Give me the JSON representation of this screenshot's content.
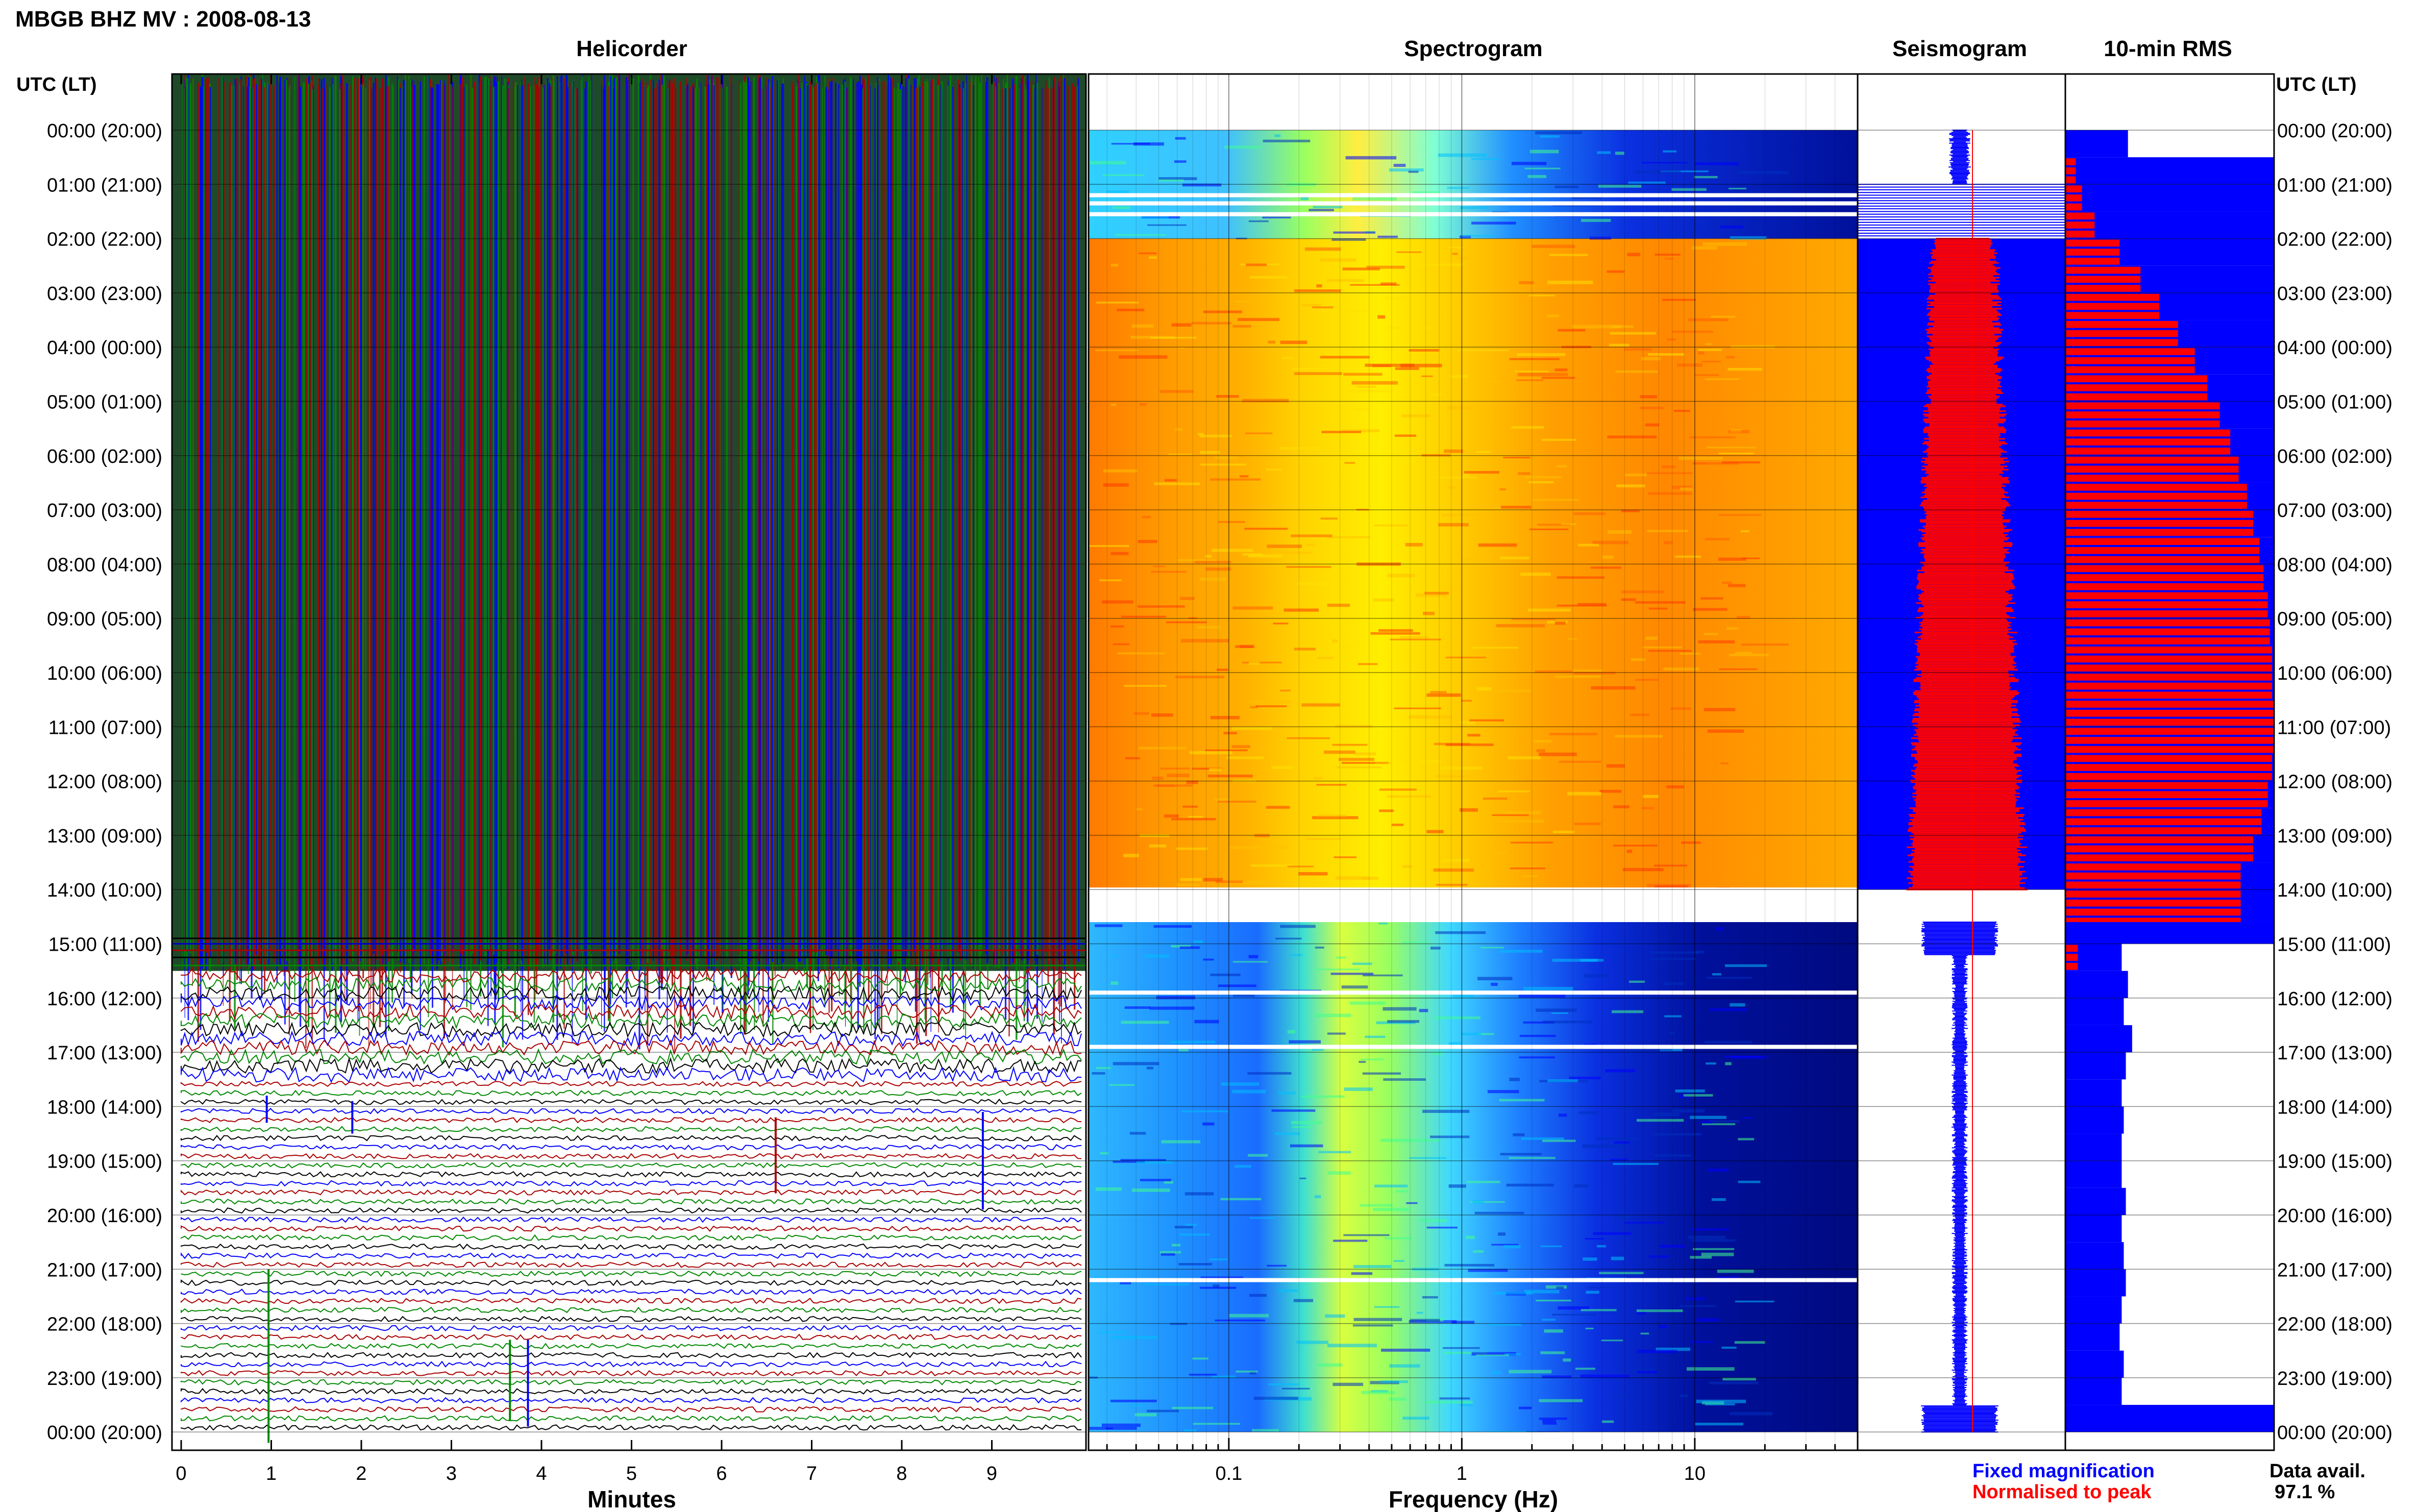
{
  "title": "MBGB BHZ MV : 2008-08-13",
  "time_axis": {
    "label": "UTC (LT)",
    "ticks": [
      "00:00 (20:00)",
      "01:00 (21:00)",
      "02:00 (22:00)",
      "03:00 (23:00)",
      "04:00 (00:00)",
      "05:00 (01:00)",
      "06:00 (02:00)",
      "07:00 (03:00)",
      "08:00 (04:00)",
      "09:00 (05:00)",
      "10:00 (06:00)",
      "11:00 (07:00)",
      "12:00 (08:00)",
      "13:00 (09:00)",
      "14:00 (10:00)",
      "15:00 (11:00)",
      "16:00 (12:00)",
      "17:00 (13:00)",
      "18:00 (14:00)",
      "19:00 (15:00)",
      "20:00 (16:00)",
      "21:00 (17:00)",
      "22:00 (18:00)",
      "23:00 (19:00)",
      "00:00 (20:00)"
    ]
  },
  "panels": {
    "helicorder": {
      "title": "Helicorder",
      "xlabel": "Minutes",
      "xticks": [
        "0",
        "1",
        "2",
        "3",
        "4",
        "5",
        "6",
        "7",
        "8",
        "9"
      ]
    },
    "spectrogram": {
      "title": "Spectrogram",
      "xlabel": "Frequency (Hz)",
      "xticks": [
        "0.1",
        "1",
        "10"
      ]
    },
    "seismogram": {
      "title": "Seismogram"
    },
    "rms": {
      "title": "10-min RMS"
    }
  },
  "legend": {
    "fixed": "Fixed magnification",
    "normalised": "Normalised to peak",
    "fixed_color": "#0000ff",
    "normalised_color": "#ff0000"
  },
  "data_avail": {
    "label": "Data avail.",
    "value": "97.1 %"
  },
  "chart_data": [
    {
      "type": "line",
      "name": "helicorder",
      "x_unit": "minutes",
      "xlim": [
        0,
        10
      ],
      "rows_hours": 24,
      "row_colors": [
        "#0000ff",
        "#aa0000",
        "#008800",
        "#000000"
      ],
      "high_activity_until_hour": 15.5,
      "data_gap_hours": [
        [
          14.0,
          14.6
        ]
      ]
    },
    {
      "type": "heatmap",
      "name": "spectrogram",
      "x_scale": "log",
      "xlim": [
        0.025,
        50
      ],
      "xticks": [
        0.1,
        1,
        10
      ],
      "ylim_hours": [
        0,
        24
      ],
      "data_gap_hours": [
        [
          14.0,
          14.6
        ]
      ],
      "colormap": [
        "#00008b",
        "#0000ff",
        "#00bfff",
        "#7fffd4",
        "#ffff00",
        "#ff8c00",
        "#ff0000"
      ]
    },
    {
      "type": "bar",
      "name": "10-min RMS",
      "orientation": "horizontal",
      "bin_minutes": 10,
      "xlim": [
        0,
        1
      ],
      "hours": [
        0.0,
        0.5,
        1.0,
        1.5,
        2.0,
        2.5,
        3.0,
        3.5,
        4.0,
        4.5,
        5.0,
        5.5,
        6.0,
        6.5,
        7.0,
        7.5,
        8.0,
        8.5,
        9.0,
        9.5,
        10.0,
        10.5,
        11.0,
        11.5,
        12.0,
        12.5,
        13.0,
        13.5,
        14.6,
        15.0,
        15.5,
        16.0,
        16.5,
        17.0,
        17.5,
        18.0,
        18.5,
        19.0,
        19.5,
        20.0,
        20.5,
        21.0,
        21.5,
        22.0,
        22.5,
        23.0,
        23.5
      ],
      "fixed_values": [
        0.3,
        1.0,
        1.0,
        1.0,
        1.0,
        1.0,
        1.0,
        1.0,
        1.0,
        1.0,
        1.0,
        1.0,
        1.0,
        1.0,
        1.0,
        1.0,
        1.0,
        1.0,
        1.0,
        1.0,
        1.0,
        1.0,
        1.0,
        1.0,
        1.0,
        1.0,
        1.0,
        1.0,
        1.0,
        0.27,
        0.3,
        0.28,
        0.32,
        0.29,
        0.27,
        0.28,
        0.27,
        0.27,
        0.29,
        0.27,
        0.28,
        0.29,
        0.27,
        0.26,
        0.28,
        0.27,
        1.0
      ],
      "normalised_values": [
        0.0,
        0.05,
        0.08,
        0.14,
        0.26,
        0.36,
        0.45,
        0.54,
        0.62,
        0.68,
        0.74,
        0.79,
        0.83,
        0.87,
        0.9,
        0.93,
        0.95,
        0.97,
        0.98,
        0.99,
        0.99,
        1.0,
        1.0,
        0.99,
        0.97,
        0.94,
        0.9,
        0.84,
        0.0,
        0.06,
        0.0,
        0.0,
        0.0,
        0.0,
        0.0,
        0.0,
        0.0,
        0.0,
        0.0,
        0.0,
        0.0,
        0.0,
        0.0,
        0.0,
        0.0,
        0.0,
        0.0
      ]
    }
  ]
}
